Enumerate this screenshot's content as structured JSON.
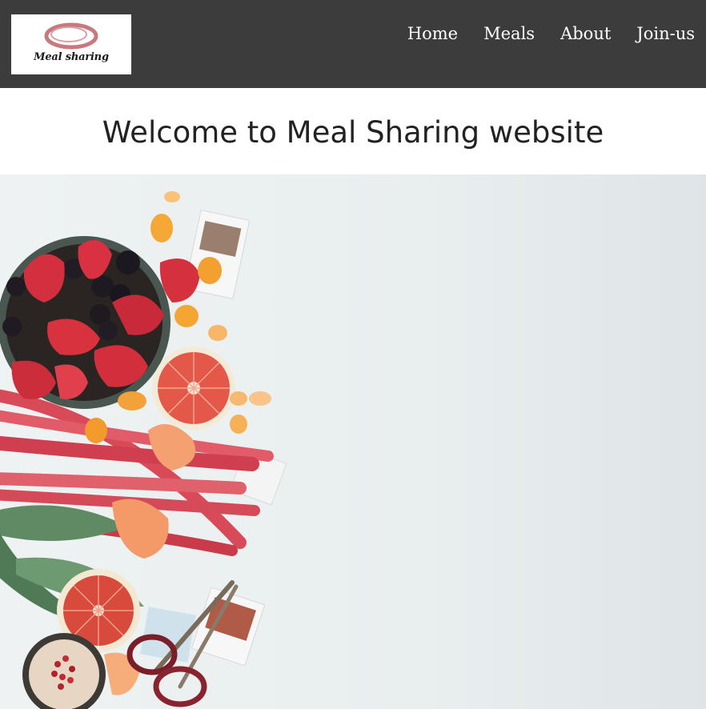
{
  "logo": {
    "text": "Meal sharing"
  },
  "nav": {
    "items": [
      {
        "label": "Home"
      },
      {
        "label": "Meals"
      },
      {
        "label": "About"
      },
      {
        "label": "Join-us"
      }
    ]
  },
  "main": {
    "title": "Welcome to Meal Sharing website"
  },
  "colors": {
    "navbar_bg": "#3c3c3c",
    "nav_text": "#ffffff",
    "title_text": "#222222",
    "hero_bg": "#eef2f2"
  }
}
